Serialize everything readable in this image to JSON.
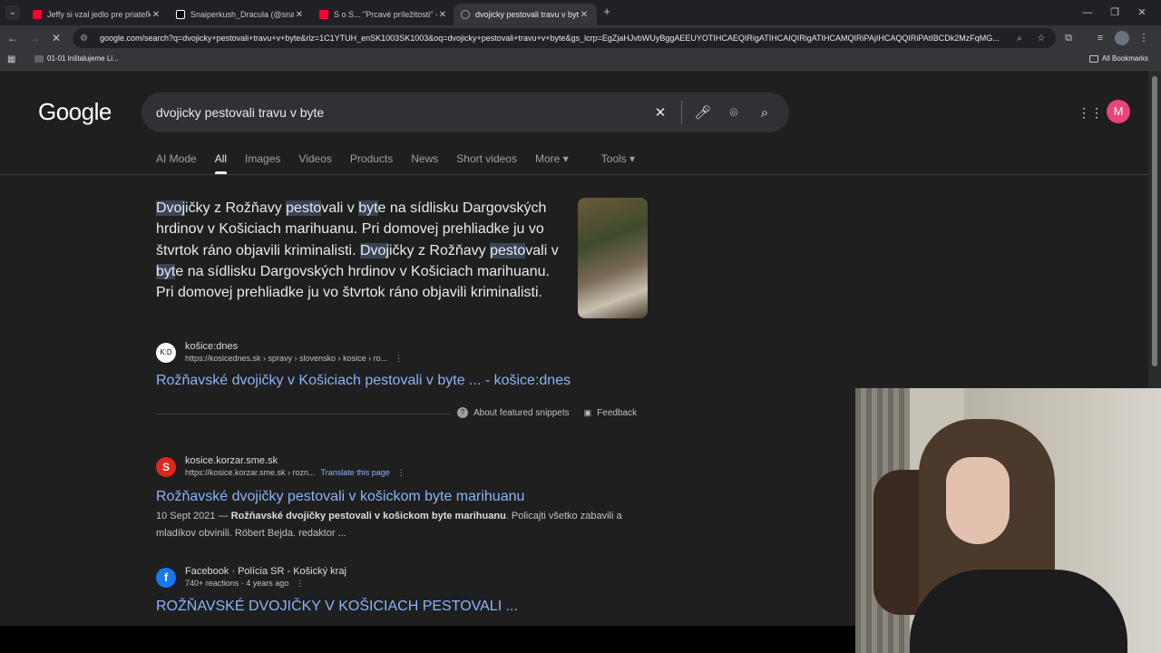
{
  "browser": {
    "tabs": [
      {
        "title": "Jeffy si vzal jedlo pre priateľku a",
        "favicon_color": "#ff0033"
      },
      {
        "title": "Snaiperkush_Dracula (@snaiper",
        "favicon_color": "#ffffff"
      },
      {
        "title": "S o S... \"Prcavé príležitosti\" - Yo",
        "favicon_color": "#ff0033"
      },
      {
        "title": "dvojicky pestovali travu v byte",
        "favicon_color": "#9aa0a6"
      }
    ],
    "url": "google.com/search?q=dvojicky+pestovali+travu+v+byte&rlz=1C1YTUH_enSK1003SK1003&oq=dvojicky+pestovali+travu+v+byte&gs_lcrp=EgZjaHJvbWUyBggAEEUYOTIHCAEQIRigATIHCAIQIRigATIHCAMQIRiPAjIHCAQQIRiPAtIBCDk2MzFqMG...",
    "bookmarks": [
      {
        "label": "01-01 Inštalujeme Li..."
      }
    ],
    "all_bookmarks": "All Bookmarks"
  },
  "google": {
    "logo": "Google",
    "query": "dvojicky pestovali travu v byte",
    "avatar_letter": "M",
    "tabs": [
      "AI Mode",
      "All",
      "Images",
      "Videos",
      "Products",
      "News",
      "Short videos",
      "More ▾",
      "Tools ▾"
    ],
    "active_tab": "All"
  },
  "snippet": {
    "parts": [
      {
        "t": "Dvoj",
        "h": true
      },
      {
        "t": "ičky z Rožňavy ",
        "h": false
      },
      {
        "t": "pesto",
        "h": true
      },
      {
        "t": "vali v ",
        "h": false
      },
      {
        "t": "byt",
        "h": true
      },
      {
        "t": "e na sídlisku Dargovských hrdinov v Košiciach marihuanu. Pri domovej prehliadke ju vo štvrtok ráno objavili kriminalisti. ",
        "h": false
      },
      {
        "t": "Dvoj",
        "h": true
      },
      {
        "t": "ičky z Rožňavy ",
        "h": false
      },
      {
        "t": "pesto",
        "h": true
      },
      {
        "t": "vali v ",
        "h": false
      },
      {
        "t": "byt",
        "h": true
      },
      {
        "t": "e na sídlisku Dargovských hrdinov v Košiciach marihuanu. Pri domovej prehliadke ju vo štvrtok ráno objavili kriminalisti.",
        "h": false
      }
    ],
    "source_name": "košice:dnes",
    "source_url": "https://kosicednes.sk › spravy › slovensko › kosice › ro...",
    "title": "Rožňavské dvojičky v Košiciach pestovali v byte ... - košice:dnes",
    "about": "About featured snippets",
    "feedback": "Feedback"
  },
  "results": [
    {
      "source_name": "kosice.korzar.sme.sk",
      "source_url": "https://kosice.korzar.sme.sk › rozn...",
      "translate": "Translate this page",
      "title": "Rožňavské dvojičky pestovali v košickom byte marihuanu",
      "date": "10 Sept 2021 — ",
      "bold": "Rožňavské dvojičky pestovali v košickom byte marihuanu",
      "desc": ". Policajti všetko zabavili a mladíkov obvinili. Róbert Bejda. redaktor ...",
      "favicon_color": "#e1251b",
      "favicon_letter": "S"
    },
    {
      "source_name": "Facebook · Polícia SR - Košický kraj",
      "source_url": "740+ reactions · 4 years ago",
      "title": "ROŽŇAVSKÉ DVOJIČKY V KOŠICIACH PESTOVALI ...",
      "favicon_color": "#1877f2",
      "favicon_letter": "f"
    }
  ],
  "colors": {
    "link": "#8ab4f8",
    "page_bg": "#1f1f1f",
    "highlight": "#394457"
  }
}
